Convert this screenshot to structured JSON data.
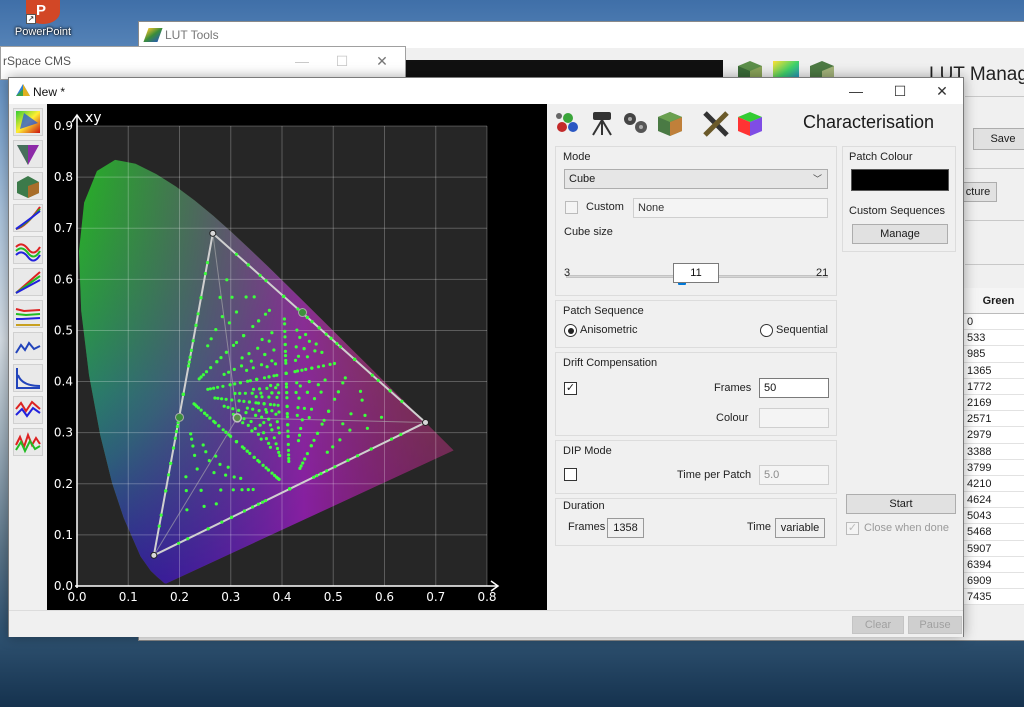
{
  "desktop": {
    "shortcut_label": "PowerPoint",
    "shortcut_glyph": "P"
  },
  "lut_window": {
    "title": "LUT Tools",
    "heading": "LUT Manage",
    "save_label": "Save",
    "cture_label": "cture",
    "table": {
      "header": "Green",
      "values": [
        "0",
        "533",
        "985",
        "1365",
        "1772",
        "2169",
        "2571",
        "2979",
        "3388",
        "3799",
        "4210",
        "4624",
        "5043",
        "5468",
        "5907",
        "6394",
        "6909",
        "7435"
      ]
    }
  },
  "cms_window": {
    "title": "rSpace CMS"
  },
  "main_window": {
    "title": "New *",
    "controls": {
      "minimize": "—",
      "maximize": "☐",
      "close": "✕"
    }
  },
  "chart_data": {
    "type": "scatter",
    "title": "",
    "axis_label": "xy",
    "xlim": [
      0.0,
      0.8
    ],
    "ylim": [
      0.0,
      0.9
    ],
    "x_ticks": [
      "0.0",
      "0.1",
      "0.2",
      "0.3",
      "0.4",
      "0.5",
      "0.6",
      "0.7",
      "0.8"
    ],
    "y_ticks": [
      "0.0",
      "0.1",
      "0.2",
      "0.3",
      "0.4",
      "0.5",
      "0.6",
      "0.7",
      "0.8",
      "0.9"
    ],
    "grid": true,
    "gamut_triangle": [
      {
        "x": 0.265,
        "y": 0.69
      },
      {
        "x": 0.68,
        "y": 0.32
      },
      {
        "x": 0.15,
        "y": 0.06
      }
    ],
    "white_point": {
      "x": 0.3127,
      "y": 0.329
    },
    "markers": [
      {
        "x": 0.2,
        "y": 0.33
      },
      {
        "x": 0.44,
        "y": 0.535
      }
    ],
    "spectral_locus": [
      [
        0.1741,
        0.005
      ],
      [
        0.1738,
        0.0049
      ],
      [
        0.1736,
        0.0049
      ],
      [
        0.173,
        0.0048
      ],
      [
        0.1714,
        0.0051
      ],
      [
        0.1689,
        0.0069
      ],
      [
        0.1644,
        0.0109
      ],
      [
        0.1566,
        0.0177
      ],
      [
        0.144,
        0.0297
      ],
      [
        0.1241,
        0.0578
      ],
      [
        0.0913,
        0.1327
      ],
      [
        0.0687,
        0.2007
      ],
      [
        0.0454,
        0.295
      ],
      [
        0.0235,
        0.4127
      ],
      [
        0.0082,
        0.5384
      ],
      [
        0.0039,
        0.6548
      ],
      [
        0.0139,
        0.7502
      ],
      [
        0.0389,
        0.812
      ],
      [
        0.0743,
        0.8338
      ],
      [
        0.1142,
        0.8262
      ],
      [
        0.1547,
        0.8059
      ],
      [
        0.1929,
        0.7816
      ],
      [
        0.2296,
        0.7543
      ],
      [
        0.2658,
        0.7243
      ],
      [
        0.3016,
        0.6923
      ],
      [
        0.3373,
        0.6589
      ],
      [
        0.3731,
        0.6245
      ],
      [
        0.4087,
        0.5896
      ],
      [
        0.4441,
        0.5547
      ],
      [
        0.4788,
        0.5202
      ],
      [
        0.5125,
        0.4866
      ],
      [
        0.5448,
        0.4544
      ],
      [
        0.5752,
        0.4242
      ],
      [
        0.6029,
        0.3965
      ],
      [
        0.627,
        0.3725
      ],
      [
        0.6482,
        0.3514
      ],
      [
        0.6658,
        0.334
      ],
      [
        0.6801,
        0.3197
      ],
      [
        0.6915,
        0.3083
      ],
      [
        0.7006,
        0.2993
      ],
      [
        0.7079,
        0.292
      ],
      [
        0.714,
        0.2859
      ],
      [
        0.719,
        0.2809
      ],
      [
        0.723,
        0.277
      ],
      [
        0.726,
        0.274
      ],
      [
        0.7283,
        0.2717
      ],
      [
        0.73,
        0.27
      ],
      [
        0.7311,
        0.2689
      ],
      [
        0.732,
        0.268
      ],
      [
        0.7327,
        0.2673
      ],
      [
        0.7334,
        0.2666
      ],
      [
        0.734,
        0.266
      ],
      [
        0.7344,
        0.2656
      ],
      [
        0.7346,
        0.2654
      ],
      [
        0.7347,
        0.2653
      ]
    ]
  },
  "panel": {
    "title": "Characterisation",
    "mode": {
      "label": "Mode",
      "selected": "Cube",
      "custom_label": "Custom",
      "custom_value": "None",
      "cube_size_label": "Cube size",
      "slider_min": "3",
      "slider_max": "21",
      "slider_value": "11"
    },
    "patch_sequence": {
      "label": "Patch Sequence",
      "option_a": "Anisometric",
      "option_b": "Sequential"
    },
    "drift": {
      "label": "Drift Compensation",
      "frames_label": "Frames",
      "frames_value": "50",
      "colour_label": "Colour"
    },
    "dip": {
      "label": "DIP Mode",
      "time_label": "Time per Patch",
      "time_value": "5.0"
    },
    "duration": {
      "label": "Duration",
      "frames_label": "Frames",
      "frames_value": "1358",
      "time_label": "Time",
      "time_value": "variable"
    },
    "patch_colour": {
      "label": "Patch Colour",
      "value": "#000000"
    },
    "custom_sequences": {
      "label": "Custom Sequences",
      "manage_label": "Manage"
    },
    "start_label": "Start",
    "close_when_done": "Close when done",
    "clear_label": "Clear",
    "pause_label": "Pause"
  },
  "icons": {
    "left_tools": [
      "gamut-cie-icon",
      "gamut-triangle-icon",
      "gamut-cube-icon",
      "rgb-curve-icon",
      "gamma-curve-icon",
      "rgb-lines-icon",
      "rgb-balance-icon",
      "de-graph-icon",
      "luminance-icon",
      "rgb-error-icon",
      "rgb-multi-icon"
    ],
    "right_tools": [
      "probe-icon",
      "tripod-icon",
      "generator-icon",
      "cube-icon",
      "tools-icon",
      "colour-cube-icon"
    ]
  },
  "colors": {
    "accent": "#0078d7",
    "sample_points": "#3cff3c",
    "white_point_marker": "#c0c0c0"
  }
}
